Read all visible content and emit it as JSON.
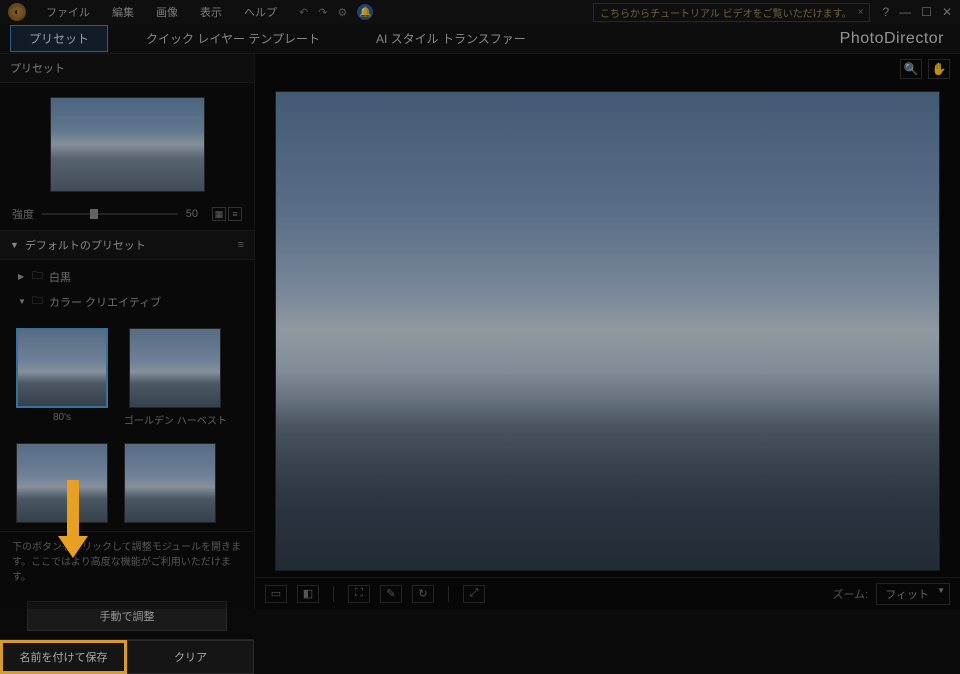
{
  "menu": {
    "file": "ファイル",
    "edit": "編集",
    "image": "画像",
    "view": "表示",
    "help": "ヘルプ"
  },
  "banner": {
    "text": "こちらからチュートリアル ビデオをご覧いただけます。",
    "close": "×"
  },
  "winctl": {
    "help": "?",
    "min": "—",
    "max": "☐",
    "close": "✕"
  },
  "toolbar": {
    "preset": "プリセット",
    "quick": "クイック レイヤー テンプレート",
    "ai": "AI スタイル トランスファー"
  },
  "brand": "PhotoDirector",
  "sidebar": {
    "header": "プリセット",
    "strength_label": "強度",
    "strength_value": "50",
    "section": "デフォルトのプリセット",
    "tree": {
      "bw": "白黒",
      "creative": "カラー クリエイティブ"
    },
    "thumbs": {
      "a": "80's",
      "b": "ゴールデン ハーベスト"
    },
    "hint": "下のボタンをクリックして調整モジュールを開きます。ここではより高度な機能がご利用いただけます。",
    "manual": "手動で調整",
    "save": "名前を付けて保存",
    "clear": "クリア"
  },
  "bottom": {
    "zoom_label": "ズーム:",
    "zoom_value": "フィット"
  }
}
